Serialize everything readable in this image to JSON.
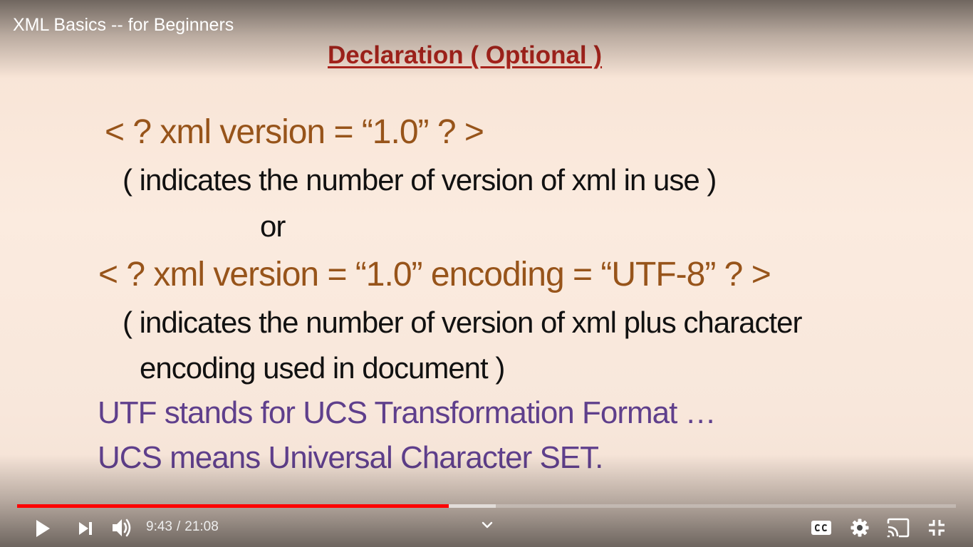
{
  "video": {
    "title": "XML Basics -- for Beginners"
  },
  "slide": {
    "title": "Declaration ( Optional )",
    "lines": [
      {
        "text": "< ? xml  version  =  “1.0” ?  >"
      },
      {
        "text": "( indicates the number of version of xml  in use )"
      },
      {
        "text": "or"
      },
      {
        "text": "< ? xml  version  =  “1.0”  encoding = “UTF-8” ? >"
      },
      {
        "text": "( indicates the number of version of xml  plus  character"
      },
      {
        "text": "encoding used in document )"
      },
      {
        "text": "UTF stands for UCS Transformation Format …"
      },
      {
        "text": "UCS means Universal Character SET."
      }
    ]
  },
  "player": {
    "current_time": "9:43",
    "duration": "21:08",
    "time_separator": "/",
    "played_fraction": 0.46,
    "buffered_fraction": 0.51,
    "progress_color": "#ff0000",
    "icons": {
      "play": "play-icon",
      "next": "next-icon",
      "volume": "volume-icon",
      "chevron": "chevron-down-icon",
      "captions": "captions-icon",
      "settings": "gear-icon",
      "cast": "cast-icon",
      "exit_fullscreen": "exit-fullscreen-icon"
    }
  }
}
